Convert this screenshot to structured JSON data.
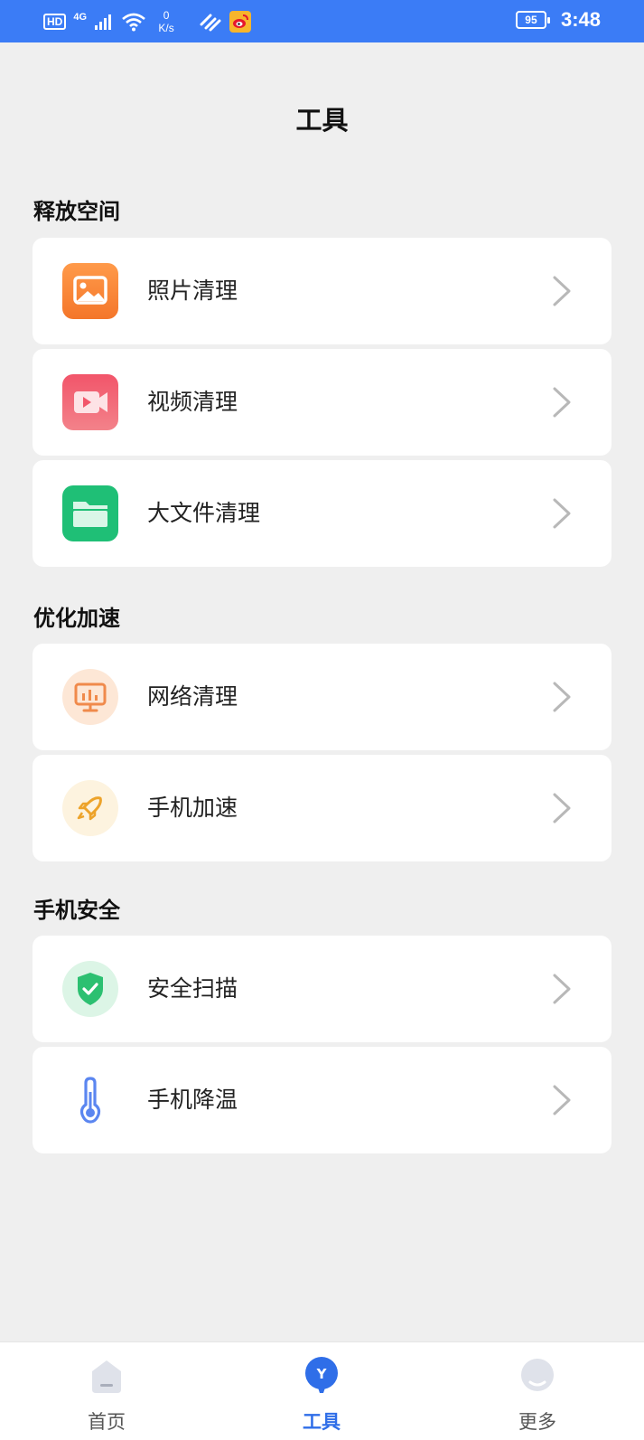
{
  "status_bar": {
    "hd": "HD",
    "network": "4G",
    "speed_value": "0",
    "speed_unit": "K/s",
    "battery": "95",
    "time": "3:48"
  },
  "page": {
    "title": "工具"
  },
  "sections": [
    {
      "title": "释放空间",
      "items": [
        {
          "label": "照片清理",
          "icon": "photo-icon"
        },
        {
          "label": "视频清理",
          "icon": "video-icon"
        },
        {
          "label": "大文件清理",
          "icon": "folder-icon"
        }
      ]
    },
    {
      "title": "优化加速",
      "items": [
        {
          "label": "网络清理",
          "icon": "network-monitor-icon"
        },
        {
          "label": "手机加速",
          "icon": "rocket-icon"
        }
      ]
    },
    {
      "title": "手机安全",
      "items": [
        {
          "label": "安全扫描",
          "icon": "shield-check-icon"
        },
        {
          "label": "手机降温",
          "icon": "thermometer-icon"
        }
      ]
    }
  ],
  "bottom_nav": {
    "items": [
      {
        "label": "首页",
        "icon": "home-icon",
        "active": false
      },
      {
        "label": "工具",
        "icon": "tools-icon",
        "active": true
      },
      {
        "label": "更多",
        "icon": "more-face-icon",
        "active": false
      }
    ]
  },
  "colors": {
    "accent": "#2f6ee8",
    "status_bar": "#3b7cf6",
    "background": "#efefef"
  }
}
